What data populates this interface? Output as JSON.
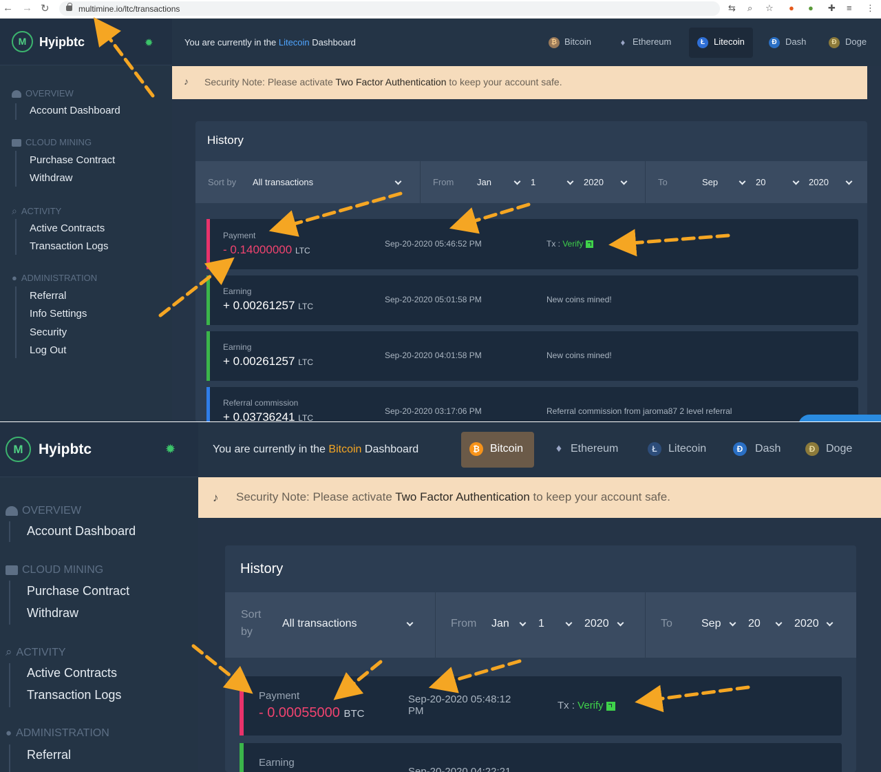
{
  "browser": {
    "url": "multimine.io/ltc/transactions",
    "back_icon": "←",
    "forward_icon": "→",
    "reload_icon": "↻"
  },
  "brand": {
    "name": "Hyipbtc"
  },
  "sidebar": {
    "overview": "OVERVIEW",
    "account_dashboard": "Account Dashboard",
    "cloud_mining": "CLOUD MINING",
    "purchase_contract": "Purchase Contract",
    "withdraw": "Withdraw",
    "activity": "ACTIVITY",
    "active_contracts": "Active Contracts",
    "transaction_logs": "Transaction Logs",
    "administration": "ADMINISTRATION",
    "referral": "Referral",
    "info_settings": "Info Settings",
    "security": "Security",
    "log_out": "Log Out"
  },
  "top": {
    "current_prefix": "You are currently in the",
    "current_suffix": "Dashboard",
    "panel1_coin": "Litecoin",
    "panel2_coin": "Bitcoin",
    "tabs": [
      "Bitcoin",
      "Ethereum",
      "Litecoin",
      "Dash",
      "Doge"
    ]
  },
  "security_note": {
    "prefix": "Security Note: Please activate",
    "highlight": "Two Factor Authentication",
    "suffix": "to keep your account safe."
  },
  "history": {
    "title": "History",
    "sort_label": "Sort by",
    "sort_label_line1": "Sort",
    "sort_label_line2": "by",
    "sort_value": "All transactions",
    "from_label": "From",
    "to_label": "To",
    "from_month": "Jan",
    "from_day": "1",
    "from_year": "2020",
    "to_month": "Sep",
    "to_day": "20",
    "to_year": "2020"
  },
  "panel1_rows": [
    {
      "type": "Payment",
      "amount": "- 0.14000000",
      "unit": "LTC",
      "date": "Sep-20-2020 05:46:52 PM",
      "tx_label": "Tx :",
      "verify": "Verify"
    },
    {
      "type": "Earning",
      "amount": "+ 0.00261257",
      "unit": "LTC",
      "date": "Sep-20-2020 05:01:58 PM",
      "desc": "New coins mined!"
    },
    {
      "type": "Earning",
      "amount": "+ 0.00261257",
      "unit": "LTC",
      "date": "Sep-20-2020 04:01:58 PM",
      "desc": "New coins mined!"
    },
    {
      "type": "Referral commission",
      "amount": "+ 0.03736241",
      "unit": "LTC",
      "date": "Sep-20-2020 03:17:06 PM",
      "desc": "Referral commission from jaroma87 2 level referral"
    }
  ],
  "panel2_rows": [
    {
      "type": "Payment",
      "amount": "- 0.00055000",
      "unit": "BTC",
      "date_line1": "Sep-20-2020 05:48:12",
      "date_line2": "PM",
      "tx_label": "Tx :",
      "verify": "Verify"
    },
    {
      "type": "Earning",
      "date_line1": "Sep-20-2020 04:22:21"
    }
  ],
  "colors": {
    "accent_ltc": "#4fa5ff",
    "accent_btc": "#f5a623",
    "negative": "#f0436f",
    "positive_bar": "#3bb54a",
    "negative_bar": "#e8336b",
    "referral_bar": "#2f7de8",
    "annotation_arrow": "#f5a623"
  }
}
